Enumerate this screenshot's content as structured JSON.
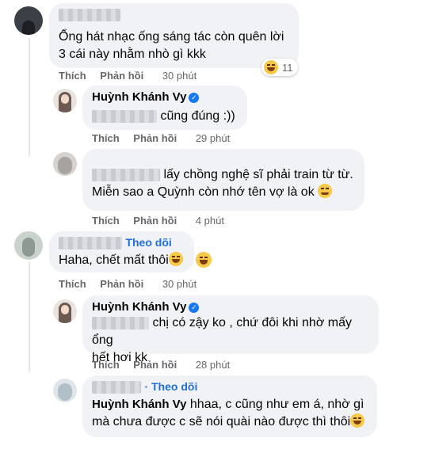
{
  "comments": [
    {
      "author": "",
      "text_lines": [
        "Ổng hát nhạc ống sáng tác còn quên lời",
        "3 cái này nhằm nhò gì kkk"
      ],
      "reaction_count": "11",
      "actions": {
        "like": "Thích",
        "reply": "Phản hồi",
        "time": "30 phút"
      }
    },
    {
      "author": "Huỳnh Khánh Vy",
      "text_suffix": "cũng đúng :))",
      "actions": {
        "like": "Thích",
        "reply": "Phản hồi",
        "time": "29 phút"
      }
    },
    {
      "author_partial": "Minh Hạnh",
      "text_lines": [
        "lấy chồng nghệ sĩ phải train từ từ.",
        "Miễn sao a Quỳnh còn nhớ tên vợ là ok"
      ],
      "actions": {
        "like": "Thích",
        "reply": "Phản hồi",
        "time": "4 phút"
      }
    },
    {
      "follow": "Theo dõi",
      "text": "Haha, chết mất thôi",
      "actions": {
        "like": "Thích",
        "reply": "Phản hồi",
        "time": "30 phút"
      }
    },
    {
      "author": "Huỳnh Khánh Vy",
      "mention": "Mỹ Hạnh",
      "text_lines": [
        "chị có zậy ko , chứ đôi khi nhờ mấy ổng",
        "hết hơi kk"
      ],
      "actions": {
        "like": "Thích",
        "reply": "Phản hồi",
        "time": "28 phút"
      }
    },
    {
      "follow": "· Theo dõi",
      "mention": "Huỳnh Khánh Vy",
      "text_lines": [
        "hhaa, c cũng như em á, nhờ gì",
        "mà chưa được c sẽ nói quài nào được thì thôi"
      ],
      "actions": {
        "like": "Thích",
        "reply": "Phản hồi",
        "time": "28 phút"
      }
    }
  ],
  "colors": {
    "bubble": "#f0f2f5",
    "meta": "#65676b",
    "link": "#216fdb",
    "verified": "#1877f2"
  }
}
